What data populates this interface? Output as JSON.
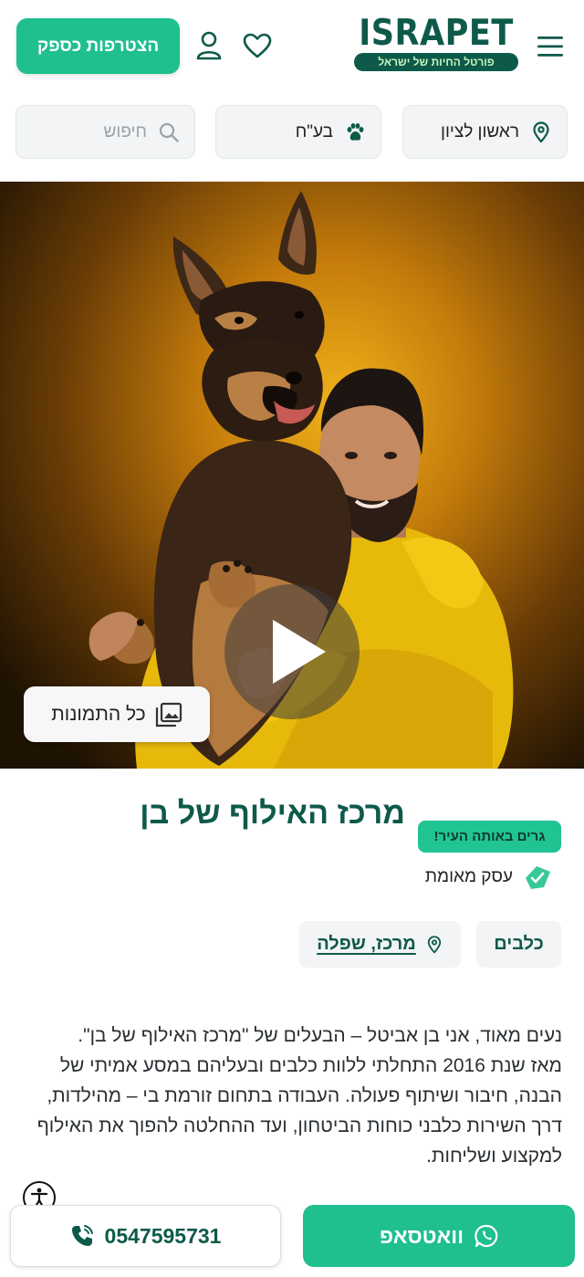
{
  "header": {
    "join_label": "הצטרפות כספק",
    "logo_text": "ISRAPET",
    "logo_tagline": "פורטל החיות של ישראל"
  },
  "filters": {
    "city": "ראשון לציון",
    "category": "בע\"ח",
    "search_placeholder": "חיפוש"
  },
  "hero": {
    "all_photos_label": "כל התמונות"
  },
  "business": {
    "title": "מרכז האילוף של בן",
    "city_badge": "גרים באותה העיר!",
    "verified_label": "עסק מאומת",
    "category_chip": "כלבים",
    "area_chip": "מרכז, שפלה"
  },
  "description": {
    "paragraphs": [
      "נעים מאוד, אני בן אביטל – הבעלים של \"מרכז האילוף של בן\".",
      "מאז שנת 2016 התחלתי ללוות כלבים ובעליהם במסע אמיתי של הבנה, חיבור ושיתוף פעולה. העבודה בתחום זורמת בי – מהילדות, דרך השירות כלבני כוחות הביטחון, ועד ההחלטה להפוך את האילוף למקצוע ושליחות."
    ]
  },
  "actions": {
    "phone": "0547595731",
    "whatsapp_label": "וואטסאפ"
  },
  "colors": {
    "brand_green": "#1fbf8f",
    "dark_green": "#0e5a4a"
  }
}
